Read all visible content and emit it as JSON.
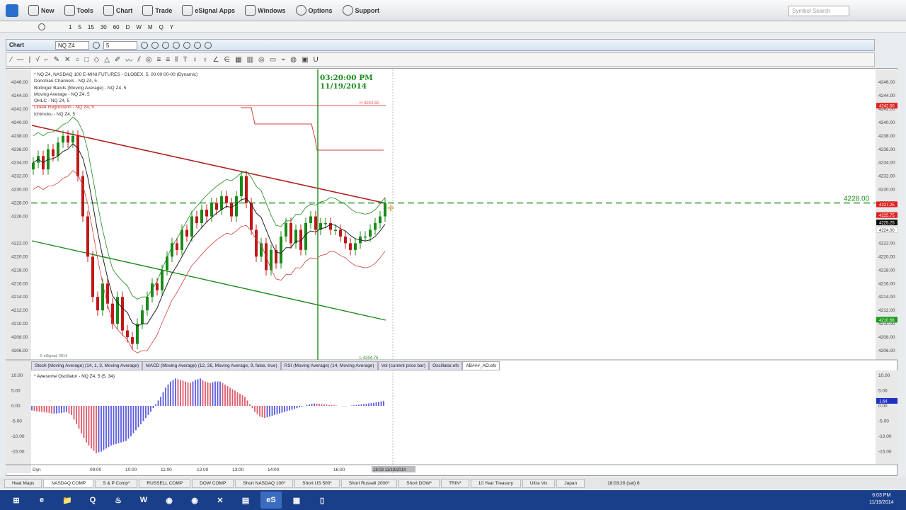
{
  "menu": {
    "items": [
      "New",
      "Tools",
      "Chart",
      "Trade",
      "eSignal Apps",
      "Windows",
      "Options",
      "Support"
    ],
    "search_placeholder": "Symbol Search"
  },
  "intervals": [
    "1",
    "5",
    "15",
    "30",
    "60",
    "D",
    "W",
    "M",
    "Q",
    "Y"
  ],
  "chart_toolbar": {
    "label": "Chart",
    "symbol": "NQ Z4",
    "interval": "5"
  },
  "drawing_tools": [
    "∕",
    "—",
    "|",
    "√",
    "⌐",
    "✎",
    "✕",
    "○",
    "□",
    "◇",
    "△",
    "✐",
    "〰",
    "⫽",
    "◎",
    "≡",
    "≡",
    "‖",
    "T",
    "♀",
    "♁",
    "∠",
    "∈",
    "▦",
    "▥",
    "◎",
    "▭",
    "⌁",
    "◍",
    "▣",
    "U"
  ],
  "legend": [
    "* NQ Z4, NASDAQ 100 E-MINI FUTURES - GLOBEX, 5, 00:00:00-00 (Dynamic)",
    "Donchian Channels - NQ Z4, 5",
    "Bollinger Bands (Moving Average) - NQ Z4, 5",
    "Moving Average - NQ Z4, 5",
    "OHLC - NQ Z4, 5",
    "Linear Regression - NQ Z4, 5",
    "Ichimoku - NQ Z4, 5"
  ],
  "timestamp": {
    "time": "03:20:00 PM",
    "date": "11/19/2014"
  },
  "watermark": "© eSignal, 2014",
  "price_axis": [
    "4246.00",
    "4244.00",
    "4242.00",
    "4240.00",
    "4238.00",
    "4236.00",
    "4234.00",
    "4232.00",
    "4230.00",
    "4228.00",
    "4226.00",
    "4222.00",
    "4220.00",
    "4218.00",
    "4216.00",
    "4214.00",
    "4212.00",
    "4210.00",
    "4208.00",
    "4206.00"
  ],
  "price_tags": [
    {
      "text": "4242.50",
      "p": 4242.5,
      "color": "#e02020"
    },
    {
      "text": "4227.25",
      "p": 4227.8,
      "color": "#e02020"
    },
    {
      "text": "4225.75",
      "p": 4226.2,
      "color": "#e02020"
    },
    {
      "text": "4225.25",
      "p": 4225.1,
      "color": "#111111"
    },
    {
      "text": "4224.00",
      "p": 4224.0,
      "color": "#ffffff"
    },
    {
      "text": "4210.68",
      "p": 4210.6,
      "color": "#1a9a1a"
    }
  ],
  "donchian_label": "H 4242.50",
  "donchian_low_label": "L 4204.75",
  "hline": {
    "price": 4228,
    "label": "4228.00",
    "color": "#1a8a1a"
  },
  "colors": {
    "up": "#1a8a1a",
    "down": "#c01818",
    "osc_up": "#5a5ae0",
    "osc_down": "#e05a6a"
  },
  "chart_data": {
    "type": "candlestick",
    "first_price": 4233,
    "closes": [
      4234,
      4235,
      4233,
      4236,
      4235,
      4237,
      4238,
      4237,
      4238,
      4232,
      4226,
      4220,
      4214,
      4212,
      4216,
      4213,
      4210,
      4214,
      4209,
      4208,
      4207,
      4210,
      4212,
      4214,
      4216,
      4215,
      4218,
      4220,
      4222,
      4221,
      4224,
      4223,
      4226,
      4225,
      4227,
      4226,
      4228,
      4227,
      4229,
      4228,
      4226,
      4229,
      4232,
      4228,
      4224,
      4220,
      4222,
      4218,
      4221,
      4219,
      4223,
      4225,
      4222,
      4224,
      4221,
      4225,
      4226,
      4224,
      4225,
      4225,
      4224,
      4224,
      4223,
      4222,
      4221,
      4222,
      4223,
      4223,
      4224,
      4225,
      4226,
      4228
    ],
    "oscillator": [
      -1.5,
      -1.8,
      -2,
      -2.2,
      -2.5,
      -2.5,
      -2.3,
      -2,
      -3,
      -6,
      -9,
      -12,
      -14,
      -15.5,
      -15,
      -14,
      -13,
      -12.5,
      -12,
      -11.5,
      -10,
      -8,
      -6,
      -4,
      -2,
      0.5,
      3,
      6,
      8,
      9,
      8.5,
      8,
      7.5,
      8.5,
      9,
      8,
      7.5,
      8,
      8,
      7,
      6,
      5,
      4,
      3,
      0.5,
      -2,
      -3.5,
      -4,
      -3.5,
      -3,
      -2.5,
      -2,
      -1.5,
      -1,
      -0.5,
      0,
      0.5,
      0.8,
      0.7,
      0.5,
      0.3,
      0.2,
      0,
      -0.1,
      0,
      0.2,
      0.4,
      0.6,
      0.8,
      1,
      1.3,
      1.6
    ]
  },
  "study_tabs": [
    "Stoch (Moving Average) (14, 1, 3, Moving Average)",
    "MACD (Moving Average) (12, 26, Moving Average, 9, false, true)",
    "RSI (Moving Average) (14, Moving Average)",
    "Vol (current price bar)",
    "Oscillator.efs",
    "AB###_AO.efs"
  ],
  "oscillator": {
    "label": "* Awesome Oscillator - NQ Z4, 5 (5, 34)",
    "axis": [
      "10.00",
      "5.00",
      "0.00",
      "-5.00",
      "-10.00",
      "-15.00"
    ],
    "tag": "1.64"
  },
  "time_axis": {
    "start": "Dyn",
    "labels": [
      "09:00",
      "10:00",
      "11:00",
      "12:00",
      "13:00",
      "14:00",
      "16:00"
    ],
    "cursor": "18:03 11/19/2014"
  },
  "bottom_tabs": [
    "Heat Maps",
    "NASDAQ COMP",
    "S & P Comp*",
    "RUSSELL COMP",
    "DOW COMP",
    "Short NASDAQ 100*",
    "Short US 500*",
    "Short Russell 2000*",
    "Short DOW*",
    "TRIN*",
    "10 Year Treasury",
    "Ultra Vix",
    "Japan"
  ],
  "status": "18:03:20 (set) 6",
  "taskbar": {
    "apps": [
      "e",
      "📁",
      "Q",
      "♨",
      "W",
      "◉",
      "◉",
      "✕",
      "▤",
      "eS",
      "▦",
      "▯"
    ],
    "time": "6:03 PM",
    "date": "11/19/2014"
  }
}
